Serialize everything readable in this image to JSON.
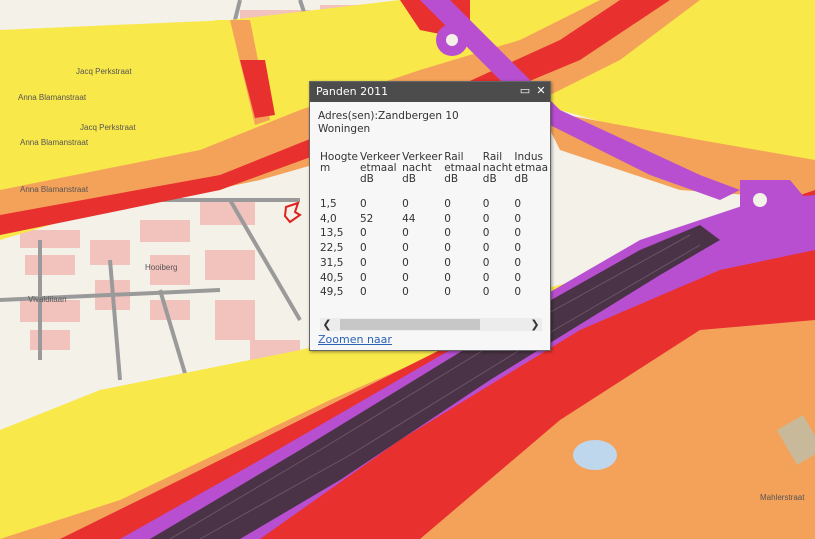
{
  "popup": {
    "title": "Panden 2011",
    "address_label": "Adres(sen):Zandbergen 10",
    "usage": "Woningen",
    "columns": [
      [
        "Hoogte",
        "m",
        ""
      ],
      [
        "Verkeer",
        "etmaal",
        "dB"
      ],
      [
        "Verkeer",
        "nacht",
        "dB"
      ],
      [
        "Rail",
        "etmaal",
        "dB"
      ],
      [
        "Rail",
        "nacht",
        "dB"
      ],
      [
        "Indus",
        "etmaa",
        "dB"
      ]
    ],
    "rows": [
      [
        "1,5",
        "0",
        "0",
        "0",
        "0",
        "0"
      ],
      [
        "4,0",
        "52",
        "44",
        "0",
        "0",
        "0"
      ],
      [
        "13,5",
        "0",
        "0",
        "0",
        "0",
        "0"
      ],
      [
        "22,5",
        "0",
        "0",
        "0",
        "0",
        "0"
      ],
      [
        "31,5",
        "0",
        "0",
        "0",
        "0",
        "0"
      ],
      [
        "40,5",
        "0",
        "0",
        "0",
        "0",
        "0"
      ],
      [
        "49,5",
        "0",
        "0",
        "0",
        "0",
        "0"
      ]
    ],
    "zoom_link": "Zoomen naar",
    "maximize_glyph": "▭",
    "close_glyph": "✕",
    "scroll_left_glyph": "❮",
    "scroll_right_glyph": "❯"
  },
  "map": {
    "street_labels": [
      "Jacq Perkstraat",
      "Anna Blamanstraat",
      "Jacq Perkstraat",
      "Anna Blamanstraat",
      "Anna Blamanstraat",
      "Hooiberg",
      "Vivaldilaan",
      "Mahlerstraat"
    ],
    "colors": {
      "background": "#f3f1e8",
      "yellow": "#f9e84a",
      "orange": "#f4a25a",
      "red": "#e8302e",
      "purple": "#b84fd0",
      "dark": "#4a3346",
      "buildings": "#f0b4b0",
      "roads": "#9a9a9a"
    }
  }
}
